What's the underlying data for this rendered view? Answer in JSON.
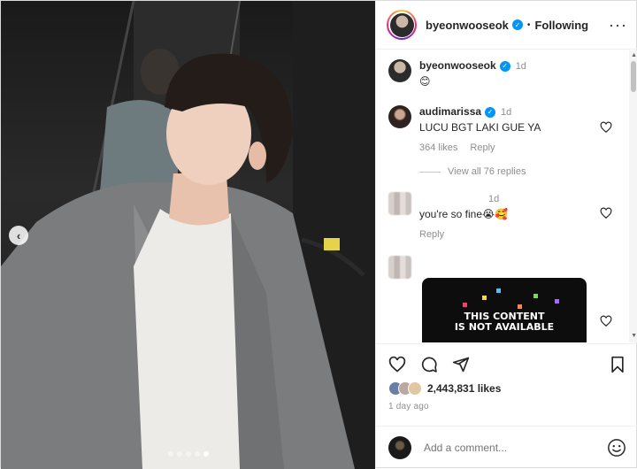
{
  "header": {
    "username": "byeonwooseok",
    "separator": "•",
    "follow_status": "Following",
    "more": "···"
  },
  "caption": {
    "username": "byeonwooseok",
    "time": "1d",
    "text": "😊"
  },
  "comments": [
    {
      "username": "audimarissa",
      "time": "1d",
      "text": "LUCU BGT LAKI GUE YA",
      "likes": "364 likes",
      "reply": "Reply",
      "view_replies": "View all 76 replies"
    },
    {
      "username": "",
      "time": "1d",
      "text": "you're so fine😭🥰",
      "reply": "Reply"
    },
    {
      "username": "",
      "unavailable_text_1": "THIS CONTENT",
      "unavailable_text_2": "IS NOT AVAILABLE"
    }
  ],
  "post": {
    "likes": "2,443,831 likes",
    "time_ago": "1 day ago"
  },
  "add_comment": {
    "placeholder": "Add a comment..."
  },
  "carousel": {
    "dot_count": 5,
    "active_index": 4
  },
  "icons": [
    "verified-icon",
    "more-icon",
    "heart-icon",
    "comment-icon",
    "share-icon",
    "bookmark-icon",
    "emoji-icon",
    "chevron-left-icon"
  ]
}
